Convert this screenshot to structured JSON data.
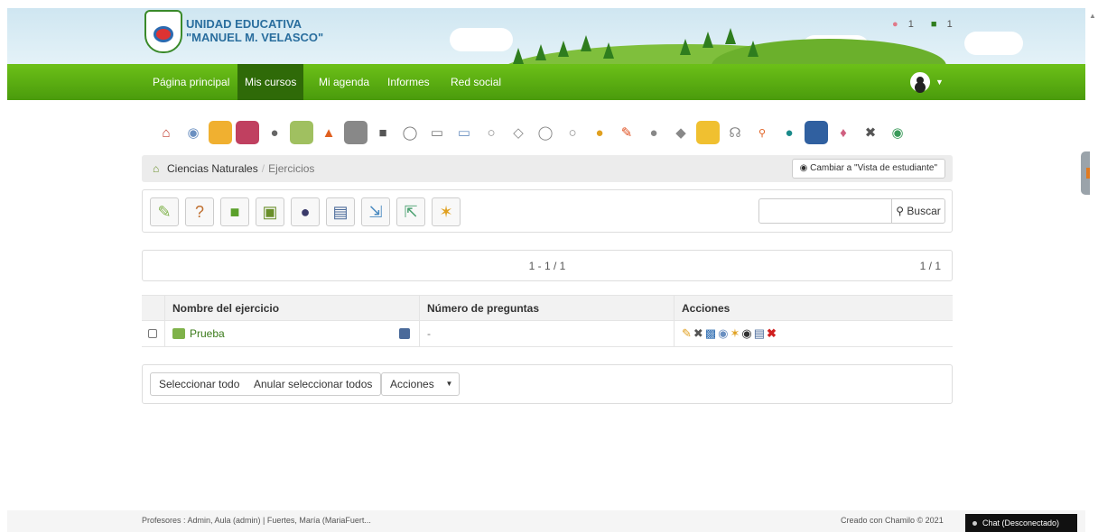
{
  "header": {
    "school_line1": "UNIDAD EDUCATIVA",
    "school_line2": "\"MANUEL M. VELASCO\"",
    "badge_users": "1",
    "badge_messages": "1"
  },
  "nav": {
    "items": [
      "Página principal",
      "Mis cursos",
      "Mi agenda",
      "Informes",
      "Red social"
    ],
    "active": "Mis cursos"
  },
  "tool_icons": [
    "home-icon",
    "course-description-icon",
    "documents-icon",
    "learning-path-icon",
    "links-icon",
    "tests-icon",
    "announcements-icon",
    "assessments-icon",
    "forums-icon",
    "attendance-icon",
    "glossary-icon",
    "calendar-icon",
    "groups-icon",
    "dropbox-icon",
    "users-icon",
    "wiki-icon",
    "chat-icon",
    "edit-icon",
    "surveys-icon",
    "notebook-icon",
    "notes-icon",
    "tracking-icon",
    "search-icon",
    "blog-icon",
    "maintenance-icon",
    "settings-icon",
    "tools-icon",
    "add-icon"
  ],
  "breadcrumb": {
    "course": "Ciencias Naturales",
    "separator": "/",
    "current": "Ejercicios",
    "student_view_button": "Cambiar a \"Vista de estudiante\""
  },
  "toolbar": {
    "actions": [
      "new-test-icon",
      "question-pool-icon",
      "folder-icon",
      "hot-potatoes-icon",
      "aiken-icon",
      "import-excel-icon",
      "export-icon",
      "qti-import-icon",
      "clean-results-icon"
    ],
    "search_placeholder": "",
    "search_button": "Buscar"
  },
  "pagination": {
    "range": "1 - 1 / 1",
    "pages": "1 / 1"
  },
  "table": {
    "headers": [
      "Nombre del ejercicio",
      "Número de preguntas",
      "Acciones"
    ],
    "rows": [
      {
        "name": "Prueba",
        "questions": "-"
      }
    ]
  },
  "bulk": {
    "select_all": "Seleccionar todo",
    "unselect_all": "Anular seleccionar todos",
    "actions": "Acciones"
  },
  "footer": {
    "teachers": "Profesores : Admin, Aula (admin) | Fuertes, María (MariaFuert...",
    "credits": "Creado con Chamilo © 2021",
    "chat": "Chat (Desconectado)"
  },
  "colors": {
    "nav_green": "#5aad12",
    "nav_active": "#2f6a08",
    "link_green": "#3a7a1a"
  }
}
